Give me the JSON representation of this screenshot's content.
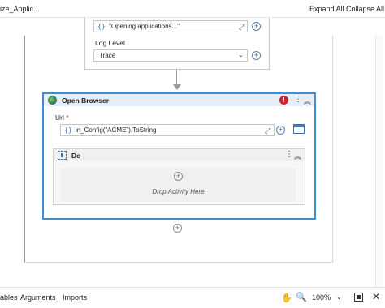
{
  "header": {
    "title": "ize_Applic...",
    "expand_all": "Expand All",
    "collapse_all": "Collapse All"
  },
  "prev_activity": {
    "message_value": "\"Opening applications...\"",
    "log_level_label": "Log Level",
    "log_level_value": "Trace",
    "brace": "{}"
  },
  "open_browser": {
    "title": "Open Browser",
    "error_glyph": "!",
    "url_label": "Url",
    "required_mark": "*",
    "url_value": "in_Config(\"ACME\").ToString",
    "brace": "{}"
  },
  "do_container": {
    "title": "Do",
    "drop_text": "Drop Activity Here"
  },
  "statusbar": {
    "tab_variables_partial": "ables",
    "tab_arguments": "Arguments",
    "tab_imports": "Imports",
    "zoom": "100%"
  },
  "icons": {
    "expand": "⤢",
    "plus": "+",
    "kebab": "⋮",
    "collapse": "︽",
    "chevron_down": "⌄",
    "hand": "✋",
    "search": "🔍",
    "close": "✕"
  },
  "colors": {
    "accent": "#3e8ed0",
    "error": "#c4262e",
    "expression": "#2b6fd6"
  }
}
